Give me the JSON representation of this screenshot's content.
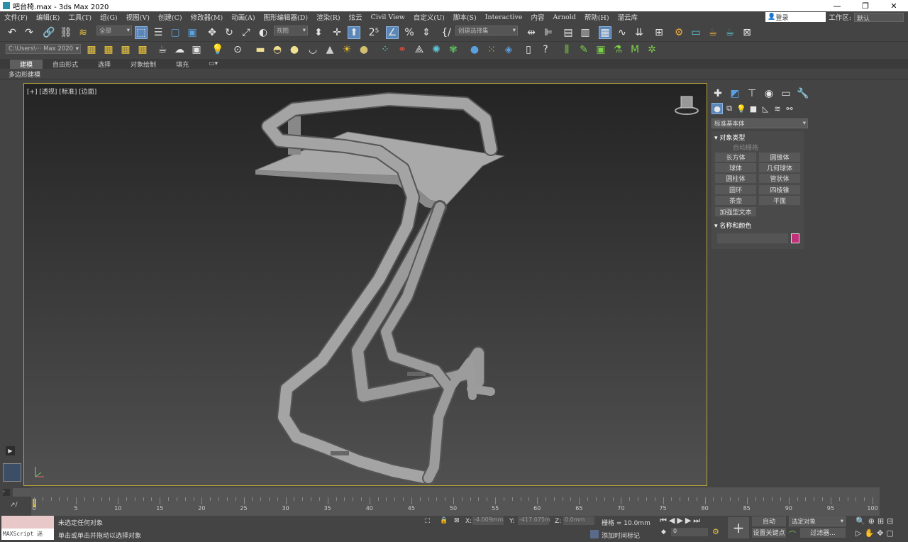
{
  "window": {
    "title": "吧台椅.max - 3ds Max 2020",
    "min": "—",
    "max": "❐",
    "close": "✕"
  },
  "menu": [
    "文件(F)",
    "编辑(E)",
    "工具(T)",
    "组(G)",
    "视图(V)",
    "创建(C)",
    "修改器(M)",
    "动画(A)",
    "图形编辑器(D)",
    "渲染(R)",
    "炫云",
    "Civil View",
    "自定义(U)",
    "脚本(S)",
    "Interactive",
    "内容",
    "Arnold",
    "帮助(H)",
    "溜云库"
  ],
  "login": "登录",
  "workspace_label": "工作区:",
  "workspace_value": "默认",
  "toolbar": {
    "filter": "全部",
    "refcoord": "视图",
    "selset": "创建选择集",
    "path": "C:\\Users\\··· Max 2020"
  },
  "ribbon": {
    "tabs": [
      "建模",
      "自由形式",
      "选择",
      "对象绘制",
      "填充"
    ],
    "active": "建模",
    "sub": "多边形建模"
  },
  "viewport": {
    "label": "[+] [透视] [标准] [边面]"
  },
  "cmd": {
    "dropdown": "标准基本体",
    "obj_type_title": "对象类型",
    "autogrid": "自动栅格",
    "buttons": [
      "长方体",
      "圆锥体",
      "球体",
      "几何球体",
      "圆柱体",
      "管状体",
      "圆环",
      "四棱锥",
      "茶壶",
      "平面"
    ],
    "extended": "加强型文本",
    "name_color_title": "名称和颜色",
    "color": "#c2307a"
  },
  "timeline": {
    "frame": "0 / 100",
    "ticks": [
      "0",
      "5",
      "10",
      "15",
      "20",
      "25",
      "30",
      "35",
      "40",
      "45",
      "50",
      "55",
      "60",
      "65",
      "70",
      "75",
      "80",
      "85",
      "90",
      "95",
      "100"
    ]
  },
  "status": {
    "maxscript": "MAXScript 迷",
    "line1": "未选定任何对象",
    "line2": "单击或单击并拖动以选择对象",
    "x_label": "X:",
    "x": "-4.009mm",
    "y_label": "Y:",
    "y": "-417.075m",
    "z_label": "Z:",
    "z": "0.0mm",
    "grid": "栅格 = 10.0mm",
    "addtime": "添加时间标记",
    "auto": "自动",
    "setkey": "设置关键点",
    "selobj": "选定对象",
    "filter": "过滤器...",
    "frame": "0"
  }
}
